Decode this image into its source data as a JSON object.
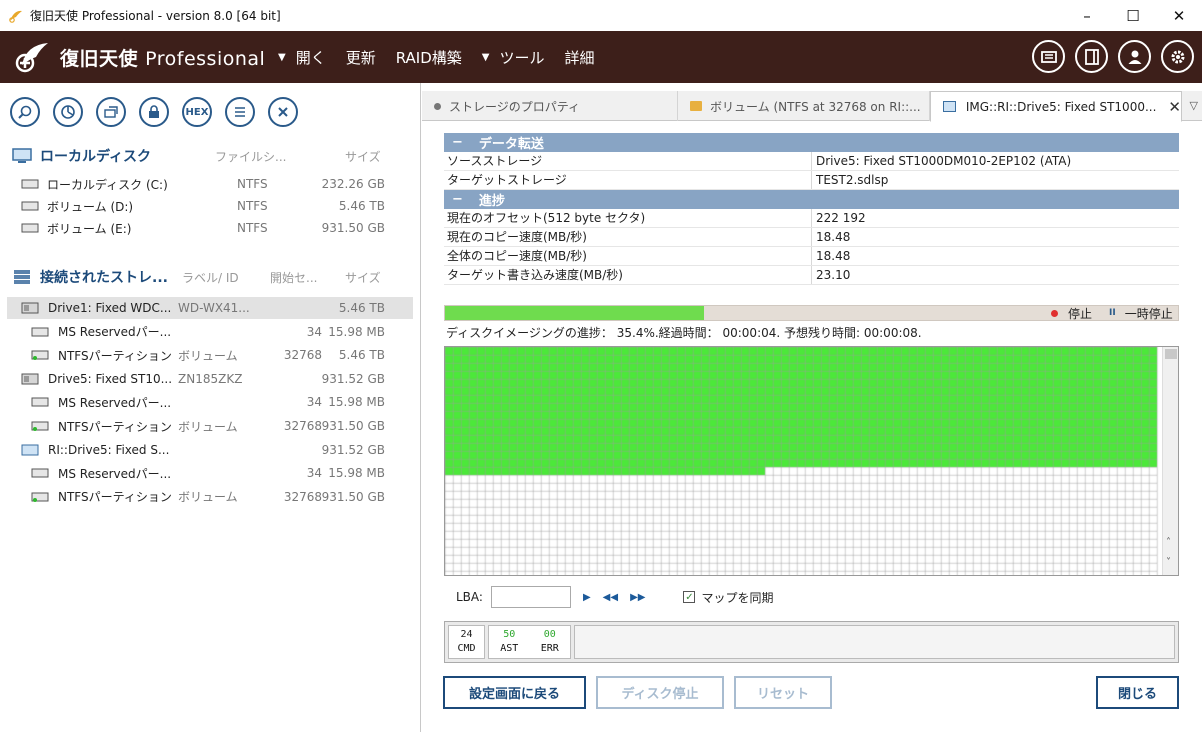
{
  "window": {
    "title": "復旧天使 Professional - version 8.0 [64 bit]",
    "minimize": "–",
    "maximize": "☐",
    "close": "✕"
  },
  "brand": {
    "name_jp": "復旧天使",
    "name_en": "Professional"
  },
  "menu": [
    {
      "label": "開く",
      "arrow": "▼"
    },
    {
      "label": "更新",
      "arrow": ""
    },
    {
      "label": "RAID構築",
      "arrow": ""
    },
    {
      "label": "ツール",
      "arrow": "▼"
    },
    {
      "label": "詳細",
      "arrow": ""
    }
  ],
  "toolbar": {
    "hex_label": "HEX"
  },
  "local_disks": {
    "title": "ローカルディスク",
    "col_fs": "ファイルシ...",
    "col_size": "サイズ",
    "items": [
      {
        "name": "ローカルディスク (C:)",
        "fs": "NTFS",
        "size": "232.26 GB"
      },
      {
        "name": "ボリューム (D:)",
        "fs": "NTFS",
        "size": "5.46 TB"
      },
      {
        "name": "ボリューム (E:)",
        "fs": "NTFS",
        "size": "931.50 GB"
      }
    ]
  },
  "connected": {
    "title": "接続されたストレ...",
    "col_label": "ラベル/ ID",
    "col_start": "開始セ...",
    "col_size": "サイズ",
    "items": [
      {
        "name": "Drive1: Fixed WDC...",
        "label": "WD-WX41...",
        "start": "",
        "size": "5.46 TB",
        "level": 0,
        "type": "drive",
        "selected": true
      },
      {
        "name": "MS Reservedパー...",
        "label": "",
        "start": "34",
        "size": "15.98 MB",
        "level": 1,
        "type": "part"
      },
      {
        "name": "NTFSパーティション",
        "label": "ボリューム",
        "start": "32768",
        "size": "5.46 TB",
        "level": 1,
        "type": "ntfs"
      },
      {
        "name": "Drive5: Fixed ST10...",
        "label": "ZN185ZKZ",
        "start": "",
        "size": "931.52 GB",
        "level": 0,
        "type": "drive"
      },
      {
        "name": "MS Reservedパー...",
        "label": "",
        "start": "34",
        "size": "15.98 MB",
        "level": 1,
        "type": "part"
      },
      {
        "name": "NTFSパーティション",
        "label": "ボリューム",
        "start": "32768",
        "size": "931.50 GB",
        "level": 1,
        "type": "ntfs"
      },
      {
        "name": "RI::Drive5: Fixed S...",
        "label": "",
        "start": "",
        "size": "931.52 GB",
        "level": 0,
        "type": "image"
      },
      {
        "name": "MS Reservedパー...",
        "label": "",
        "start": "34",
        "size": "15.98 MB",
        "level": 1,
        "type": "part"
      },
      {
        "name": "NTFSパーティション",
        "label": "ボリューム",
        "start": "32768",
        "size": "931.50 GB",
        "level": 1,
        "type": "ntfs"
      }
    ]
  },
  "tabs": [
    {
      "label": "ストレージのプロパティ"
    },
    {
      "label": "ボリューム (NTFS at 32768 on RI::..."
    },
    {
      "label": "IMG::RI::Drive5: Fixed ST1000...",
      "close": "✕"
    }
  ],
  "tab_menu": "▽",
  "properties": {
    "group1": {
      "minus": "−",
      "title": "データ転送"
    },
    "rows1": [
      {
        "k": "ソースストレージ",
        "v": "Drive5: Fixed ST1000DM010-2EP102 (ATA)"
      },
      {
        "k": "ターゲットストレージ",
        "v": "TEST2.sdlsp"
      }
    ],
    "group2": {
      "minus": "−",
      "title": "進捗"
    },
    "rows2": [
      {
        "k": "現在のオフセット(512 byte セクタ)",
        "v": "222 192"
      },
      {
        "k": "現在のコピー速度(MB/秒)",
        "v": "18.48"
      },
      {
        "k": "全体のコピー速度(MB/秒)",
        "v": "18.48"
      },
      {
        "k": "ターゲット書き込み速度(MB/秒)",
        "v": "23.10"
      }
    ]
  },
  "progress": {
    "fraction": 0.354,
    "stop": "停止",
    "pause_icon": "II",
    "pause": "一時停止",
    "text": "ディスクイメージングの進捗： 35.4%.経過時間： 00:00:04. 予想残り時間: 00:00:08."
  },
  "map": {
    "filled_color": "#4ce83a",
    "empty_color": "#ffffff",
    "grid_color": "#9e9e9e",
    "full_rows": 15,
    "partial_cols": 40,
    "scroll_up": "˄",
    "scroll_down": "˅"
  },
  "lba": {
    "label": "LBA:",
    "value": "",
    "play": "▶",
    "back": "◀◀",
    "fwd": "▶▶",
    "check": "✓",
    "sync_label": "マップを同期"
  },
  "stats": {
    "cmd": {
      "value": "24",
      "label": "CMD"
    },
    "ast": {
      "value": "50",
      "label": "AST"
    },
    "err": {
      "value": "00",
      "label": "ERR"
    },
    "value_color": "#2ea82e"
  },
  "buttons": {
    "back": "設定画面に戻る",
    "stop": "ディスク停止",
    "reset": "リセット",
    "close": "閉じる"
  }
}
